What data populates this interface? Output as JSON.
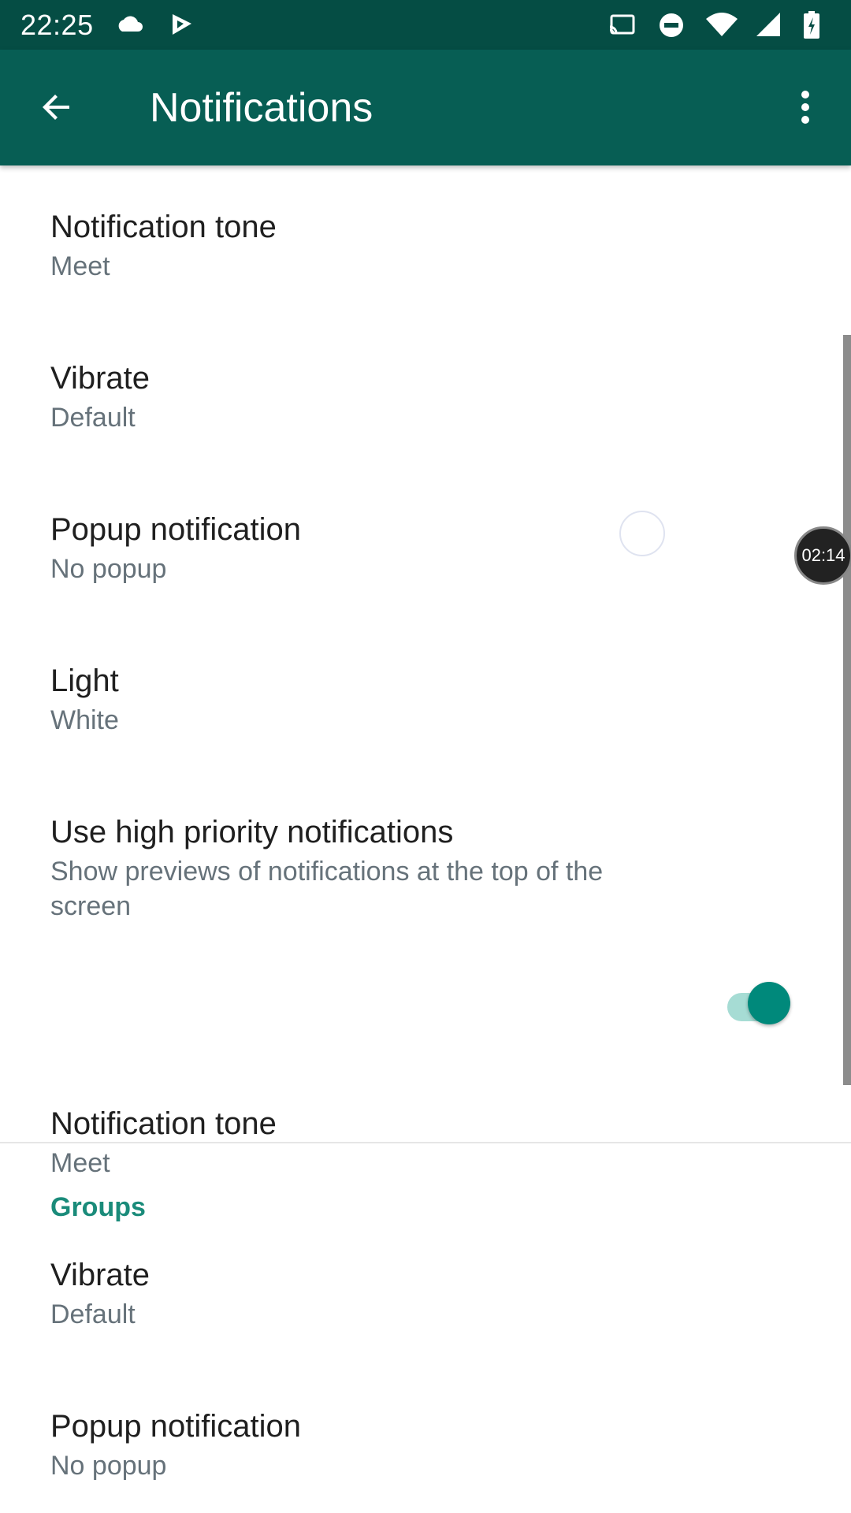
{
  "status_bar": {
    "time": "22:25",
    "left_icons": [
      "cloud-icon",
      "play-store-icon"
    ],
    "right_icons": [
      "cast-icon",
      "do-not-disturb-icon",
      "wifi-icon",
      "signal-icon",
      "battery-charging-icon"
    ]
  },
  "app_bar": {
    "title": "Notifications",
    "back_icon": "arrow-back-icon",
    "menu_icon": "more-vert-icon",
    "color": "#075e54"
  },
  "messages_section": {
    "items": [
      {
        "title": "Notification tone",
        "subtitle": "Meet"
      },
      {
        "title": "Vibrate",
        "subtitle": "Default"
      },
      {
        "title": "Popup notification",
        "subtitle": "No popup"
      },
      {
        "title": "Light",
        "subtitle": "White"
      },
      {
        "title": "Use high priority notifications",
        "subtitle": "Show previews of notifications at the top of the screen",
        "toggle": true
      }
    ]
  },
  "groups_section": {
    "header": "Groups",
    "items": [
      {
        "title": "Notification tone",
        "subtitle": "Meet"
      },
      {
        "title": "Vibrate",
        "subtitle": "Default"
      },
      {
        "title": "Popup notification",
        "subtitle": "No popup"
      }
    ]
  },
  "overlay": {
    "timer": "02:14"
  },
  "colors": {
    "accent": "#00897b",
    "section_header": "#1a8b7a"
  }
}
